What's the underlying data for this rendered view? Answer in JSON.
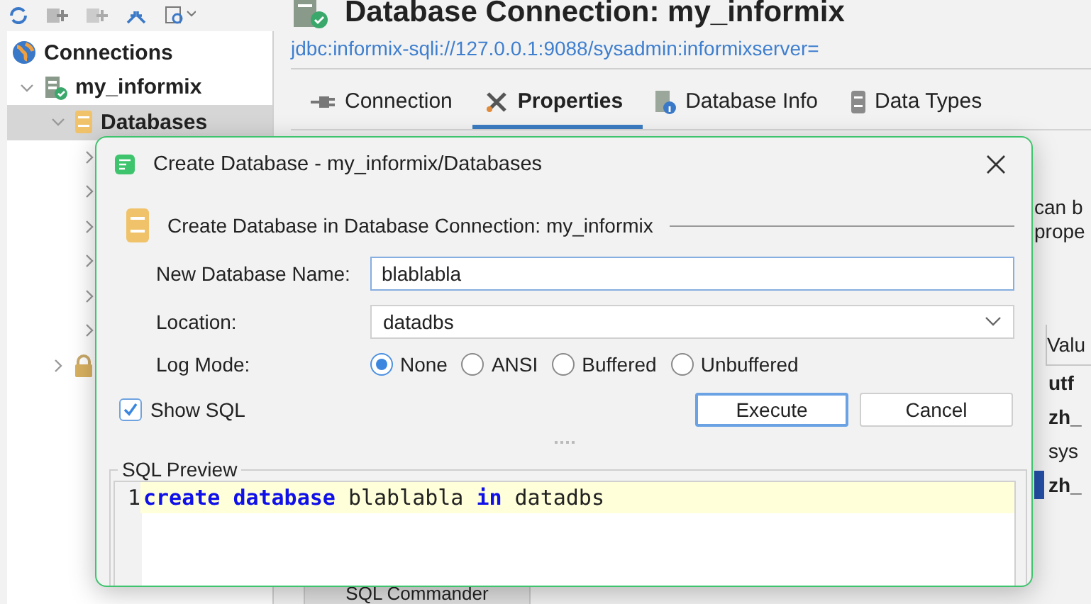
{
  "navigator": {
    "title": "Connections",
    "children": [
      {
        "label": "my_informix",
        "kind": "connection",
        "expanded": true,
        "children": [
          {
            "label": "Databases",
            "kind": "folder",
            "expanded": true,
            "selected": true,
            "children": [
              {
                "expanded": false
              },
              {
                "expanded": false
              },
              {
                "expanded": false
              },
              {
                "expanded": false
              },
              {
                "expanded": false
              },
              {
                "expanded": false
              }
            ]
          },
          {
            "kind": "locked",
            "expanded": false
          }
        ]
      }
    ]
  },
  "editor": {
    "title": "Database Connection: my_informix",
    "url": "jdbc:informix-sqli://127.0.0.1:9088/sysadmin:informixserver=",
    "tabs": [
      {
        "label": "Connection",
        "kind": "plug",
        "selected": false
      },
      {
        "label": "Properties",
        "kind": "tools",
        "selected": true
      },
      {
        "label": "Database Info",
        "kind": "info",
        "selected": false
      },
      {
        "label": "Data Types",
        "kind": "types",
        "selected": false
      }
    ],
    "description": [
      "can b",
      "prope"
    ],
    "table": {
      "column": "Valu",
      "rows": [
        {
          "text": "utf",
          "bold": true,
          "selected": false
        },
        {
          "text": "zh_",
          "bold": true,
          "selected": false
        },
        {
          "text": "sys",
          "bold": false,
          "selected": false
        },
        {
          "text": "zh_",
          "bold": true,
          "selected": true
        }
      ]
    },
    "bottom_tab": "SQL Commander"
  },
  "dialog": {
    "title": "Create Database - my_informix/Databases",
    "section": "Create Database in Database Connection: my_informix",
    "fields": [
      {
        "label": "New Database Name:",
        "kind": "text",
        "value": "blablabla"
      },
      {
        "label": "Location:",
        "kind": "select",
        "value": "datadbs"
      }
    ],
    "log_mode": {
      "label": "Log Mode:",
      "options": [
        {
          "label": "None",
          "selected": true
        },
        {
          "label": "ANSI",
          "selected": false
        },
        {
          "label": "Buffered",
          "selected": false
        },
        {
          "label": "Unbuffered",
          "selected": false
        }
      ]
    },
    "show_sql": {
      "label": "Show SQL",
      "checked": true
    },
    "buttons": [
      {
        "label": "Execute",
        "default": true
      },
      {
        "label": "Cancel",
        "default": false
      }
    ],
    "sql_preview": {
      "label": "SQL Preview",
      "lines": [
        {
          "number": "1",
          "tokens": [
            {
              "text": "create",
              "kind": "keyword"
            },
            {
              "text": "database",
              "kind": "keyword"
            },
            {
              "text": "blablabla",
              "kind": "plain"
            },
            {
              "text": "in",
              "kind": "keyword"
            },
            {
              "text": "datadbs",
              "kind": "plain"
            }
          ]
        }
      ]
    }
  }
}
